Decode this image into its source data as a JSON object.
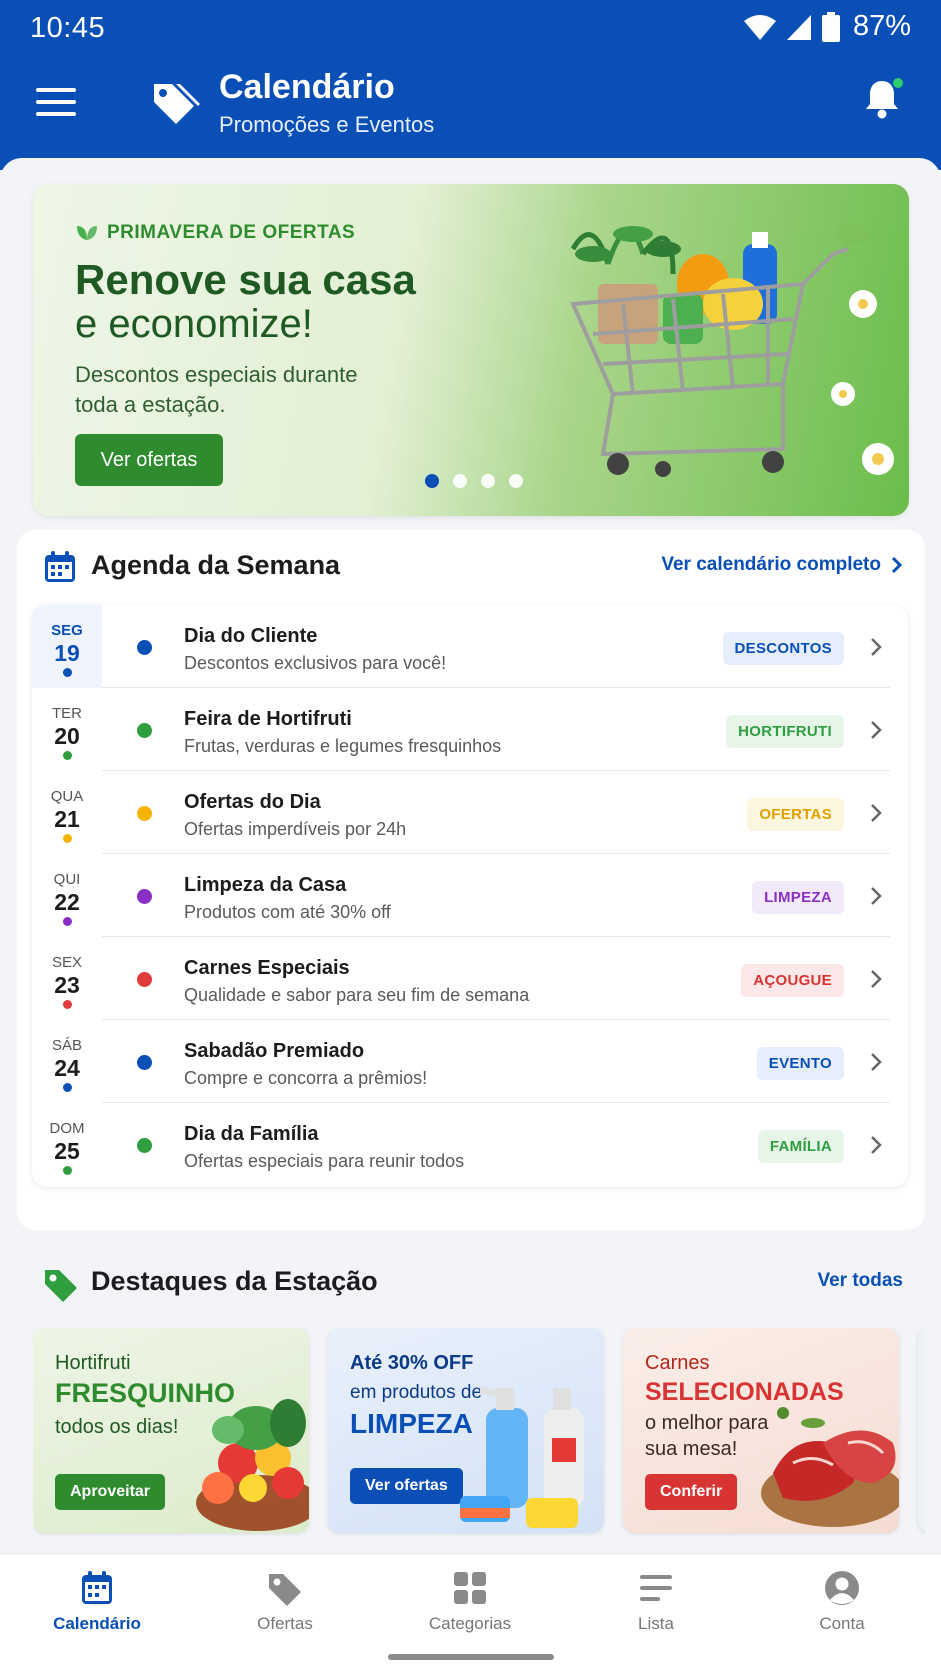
{
  "status_bar": {
    "time": "10:45",
    "battery": "87%"
  },
  "header": {
    "title": "Calendário",
    "subtitle": "Promoções e Eventos",
    "menu_icon": "hamburger-menu-icon",
    "brand_icon": "tags-icon",
    "notification_icon": "bell-icon",
    "accent_color": "#0a4fb5"
  },
  "banner": {
    "eyebrow": "PRIMAVERA DE OFERTAS",
    "headline_line1": "Renove sua casa",
    "headline_line2": "e economize!",
    "description": "Descontos especiais durante toda a estação.",
    "cta_label": "Ver ofertas",
    "slide_count": 4,
    "active_slide": 1,
    "image": "shopping-cart-with-plants-and-products"
  },
  "agenda": {
    "title": "Agenda da Semana",
    "link": "Ver calendário completo",
    "items": [
      {
        "dow": "SEG",
        "day": "19",
        "name": "Dia do Cliente",
        "desc": "Descontos exclusivos para você!",
        "tag": "DESCONTOS",
        "color": "#0a4fb5",
        "tag_bg": "#e7eefb",
        "tag_fg": "#0a4fb5"
      },
      {
        "dow": "TER",
        "day": "20",
        "name": "Feira de Hortifruti",
        "desc": "Frutas, verduras e legumes fresquinhos",
        "tag": "HORTIFRUTI",
        "color": "#2e9e3e",
        "tag_bg": "#e6f5e8",
        "tag_fg": "#2e9e3e"
      },
      {
        "dow": "QUA",
        "day": "21",
        "name": "Ofertas do Dia",
        "desc": "Ofertas imperdíveis por 24h",
        "tag": "OFERTAS",
        "color": "#f5b400",
        "tag_bg": "#fdf6de",
        "tag_fg": "#e0a100"
      },
      {
        "dow": "QUI",
        "day": "22",
        "name": "Limpeza da Casa",
        "desc": "Produtos com até 30% off",
        "tag": "LIMPEZA",
        "color": "#8a2fc4",
        "tag_bg": "#f2e9fa",
        "tag_fg": "#8a2fc4"
      },
      {
        "dow": "SEX",
        "day": "23",
        "name": "Carnes Especiais",
        "desc": "Qualidade e sabor para seu fim de semana",
        "tag": "AÇOUGUE",
        "color": "#e03c3c",
        "tag_bg": "#fce8e8",
        "tag_fg": "#d93434"
      },
      {
        "dow": "SÁB",
        "day": "24",
        "name": "Sabadão Premiado",
        "desc": "Compre e concorra a prêmios!",
        "tag": "EVENTO",
        "color": "#0a4fb5",
        "tag_bg": "#e7eefb",
        "tag_fg": "#0a4fb5"
      },
      {
        "dow": "DOM",
        "day": "25",
        "name": "Dia da Família",
        "desc": "Ofertas especiais para reunir todos",
        "tag": "FAMÍLIA",
        "color": "#2e9e3e",
        "tag_bg": "#e6f5e8",
        "tag_fg": "#2e9e3e"
      }
    ]
  },
  "highlights": {
    "title": "Destaques da Estação",
    "link": "Ver todas",
    "cards": [
      {
        "l1": "Hortifruti",
        "l2": "FRESQUINHO",
        "l3": "todos os dias!",
        "button": "Aproveitar",
        "image": "vegetable-basket"
      },
      {
        "l1": "Até 30% OFF",
        "l2": "em produtos de",
        "l3": "LIMPEZA",
        "button": "Ver ofertas",
        "image": "cleaning-products"
      },
      {
        "l1": "Carnes",
        "l2": "SELECIONADAS",
        "l3": "o melhor para sua mesa!",
        "button": "Conferir",
        "image": "steaks-on-board"
      }
    ]
  },
  "bottom_nav": {
    "items": [
      {
        "label": "Calendário",
        "icon": "calendar-icon",
        "active": true
      },
      {
        "label": "Ofertas",
        "icon": "tag-icon",
        "active": false
      },
      {
        "label": "Categorias",
        "icon": "grid-icon",
        "active": false
      },
      {
        "label": "Lista",
        "icon": "list-icon",
        "active": false
      },
      {
        "label": "Conta",
        "icon": "account-icon",
        "active": false
      }
    ]
  }
}
